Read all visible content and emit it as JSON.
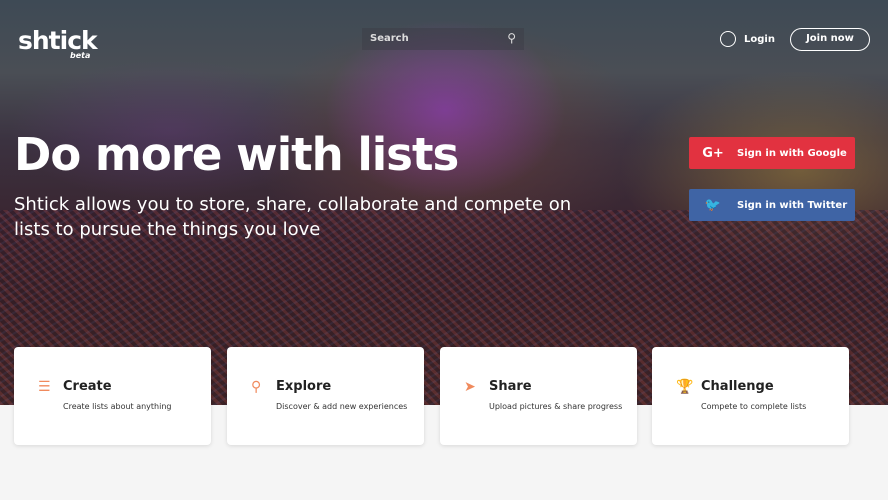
{
  "header": {
    "logo": "shtick",
    "logo_badge": "beta",
    "search_placeholder": "Search",
    "login": "Login",
    "join": "Join now"
  },
  "hero": {
    "title": "Do more with lists",
    "subtitle": "Shtick allows you to store, share, collaborate and compete on lists to pursue the things you love",
    "google": "Sign in with Google",
    "google_icon": "G+",
    "twitter": "Sign in with Twitter",
    "twitter_icon": "🐦"
  },
  "features": [
    {
      "icon": "☰",
      "title": "Create",
      "desc": "Create lists about anything"
    },
    {
      "icon": "⚲",
      "title": "Explore",
      "desc": "Discover & add new experiences"
    },
    {
      "icon": "➤",
      "title": "Share",
      "desc": "Upload pictures & share progress"
    },
    {
      "icon": "🏆",
      "title": "Challenge",
      "desc": "Compete to complete lists"
    }
  ]
}
